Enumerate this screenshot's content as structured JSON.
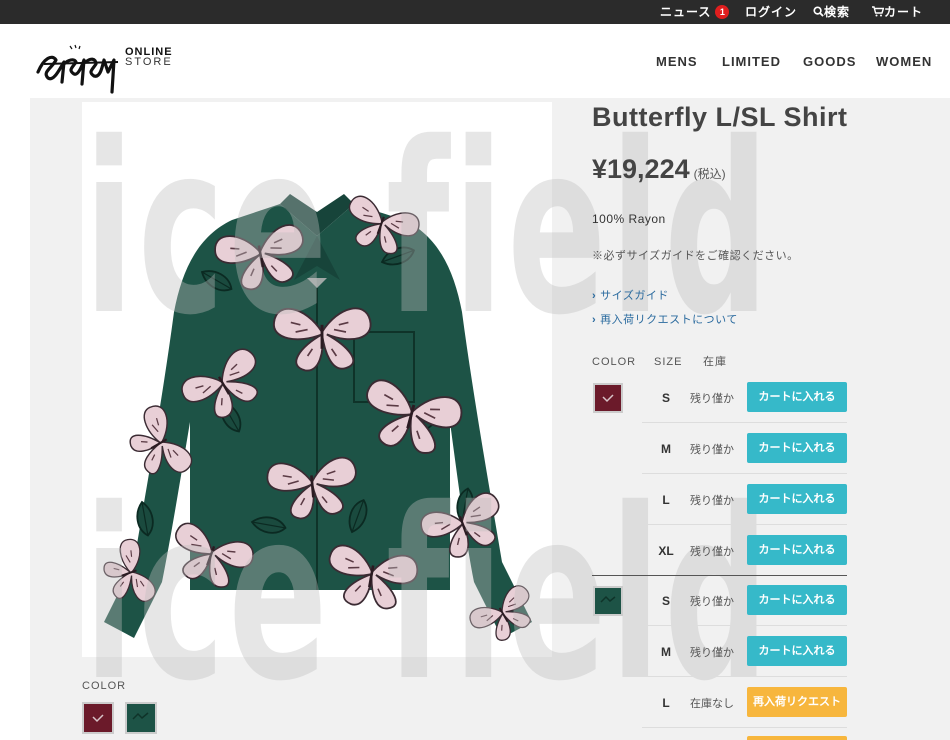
{
  "topbar": {
    "news_label": "ニュース",
    "news_count": "1",
    "login_label": "ログイン",
    "search_label": "検索",
    "cart_label": "カート"
  },
  "header": {
    "logo_line1": "ONLINE",
    "logo_line2": "STORE",
    "nav": [
      "MENS",
      "LIMITED",
      "GOODS",
      "WOMEN"
    ]
  },
  "watermark": {
    "text": "ice field"
  },
  "product": {
    "title": "Butterfly L/SL Shirt",
    "price": "¥19,224",
    "tax_note": "(税込)",
    "material": "100% Rayon",
    "notice": "※必ずサイズガイドをご確認ください。",
    "links": [
      "サイズガイド",
      "再入荷リクエストについて"
    ],
    "color_section_label": "COLOR"
  },
  "stock_table": {
    "headers": {
      "color": "COLOR",
      "size": "SIZE",
      "stock": "在庫"
    },
    "colors": [
      {
        "name": "burgundy",
        "hex": "#6b1a2a",
        "rows": [
          {
            "size": "S",
            "stock": "残り僅か",
            "button": "カートに入れる"
          },
          {
            "size": "M",
            "stock": "残り僅か",
            "button": "カートに入れる"
          },
          {
            "size": "L",
            "stock": "残り僅か",
            "button": "カートに入れる"
          },
          {
            "size": "XL",
            "stock": "残り僅か",
            "button": "カートに入れる"
          }
        ]
      },
      {
        "name": "green",
        "hex": "#1d5346",
        "rows": [
          {
            "size": "S",
            "stock": "残り僅か",
            "button": "カートに入れる"
          },
          {
            "size": "M",
            "stock": "残り僅か",
            "button": "カートに入れる"
          },
          {
            "size": "L",
            "stock": "在庫なし",
            "button": "再入荷リクエスト"
          }
        ]
      }
    ]
  },
  "colors": {
    "accent_cart": "#36b9c9",
    "accent_restock": "#f7b63d",
    "shirt_green": "#1d5346",
    "shirt_burgundy": "#6b1a2a"
  }
}
